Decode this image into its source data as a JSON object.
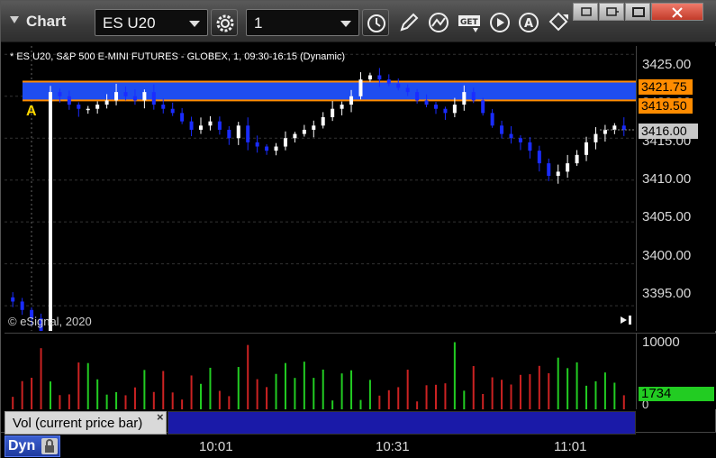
{
  "titlebar": {
    "title": "Chart",
    "symbol": "ES U20",
    "interval": "1"
  },
  "toolbar": {
    "icons": [
      "gear-icon",
      "clock-icon",
      "pencil-icon",
      "study-icon",
      "get-icon",
      "play-icon",
      "alert-icon",
      "link-icon"
    ]
  },
  "window_buttons": [
    "restore-down-icon",
    "link-window-icon",
    "maximize-icon",
    "close-icon"
  ],
  "chart": {
    "header": "* ES U20, S&P 500 E-MINI FUTURES - GLOBEX, 1, 09:30-16:15 (Dynamic)",
    "copyright": "© eSignal, 2020",
    "anchor": "A",
    "price_ticks": [
      "3425.00",
      "3420.00",
      "3415.00",
      "3410.00",
      "3405.00",
      "3400.00",
      "3395.00"
    ],
    "tags": {
      "high": "3421.75",
      "low": "3419.50",
      "last": "3416.00"
    },
    "colors": {
      "band": "#1e4df0",
      "band_line": "#ff8c00",
      "up_candle": "#ffffff",
      "down_candle": "#1a2cff",
      "vol_up": "#22cc22",
      "vol_down": "#cc2222"
    }
  },
  "volume": {
    "ticks": [
      "10000",
      "0"
    ],
    "last": "1734",
    "study_label": "Vol (current price bar)",
    "close_glyph": "×"
  },
  "time_axis": {
    "labels": [
      "10:01",
      "10:31",
      "11:01"
    ]
  },
  "status": {
    "mode": "Dyn"
  },
  "chart_data": {
    "type": "candlestick",
    "title": "* ES U20, S&P 500 E-MINI FUTURES - GLOBEX, 1, 09:30-16:15 (Dynamic)",
    "ylim": [
      3392,
      3426
    ],
    "x_labels": [
      "10:01",
      "10:31",
      "11:01"
    ],
    "band": [
      3419.5,
      3421.75
    ],
    "last": 3416.0,
    "close_series": [
      3395.5,
      3394.5,
      3393.5,
      3392.0,
      3420.5,
      3420.0,
      3419.0,
      3418.5,
      3418.5,
      3419.0,
      3419.5,
      3420.5,
      3420.0,
      3419.5,
      3420.5,
      3419.0,
      3418.5,
      3418.0,
      3417.0,
      3416.0,
      3416.5,
      3417.0,
      3416.0,
      3415.0,
      3416.5,
      3414.5,
      3414.0,
      3413.5,
      3414.0,
      3415.0,
      3415.5,
      3416.0,
      3416.5,
      3417.5,
      3418.5,
      3419.0,
      3420.0,
      3422.0,
      3422.5,
      3422.0,
      3421.5,
      3421.0,
      3420.5,
      3419.5,
      3419.0,
      3418.5,
      3418.0,
      3419.0,
      3420.5,
      3419.5,
      3418.0,
      3416.5,
      3415.5,
      3415.0,
      3414.5,
      3413.5,
      3412.0,
      3410.5,
      3411.0,
      3412.0,
      3413.0,
      3414.5,
      3415.5,
      3416.0,
      3416.5,
      3416.0
    ],
    "volume_max": 10000
  }
}
